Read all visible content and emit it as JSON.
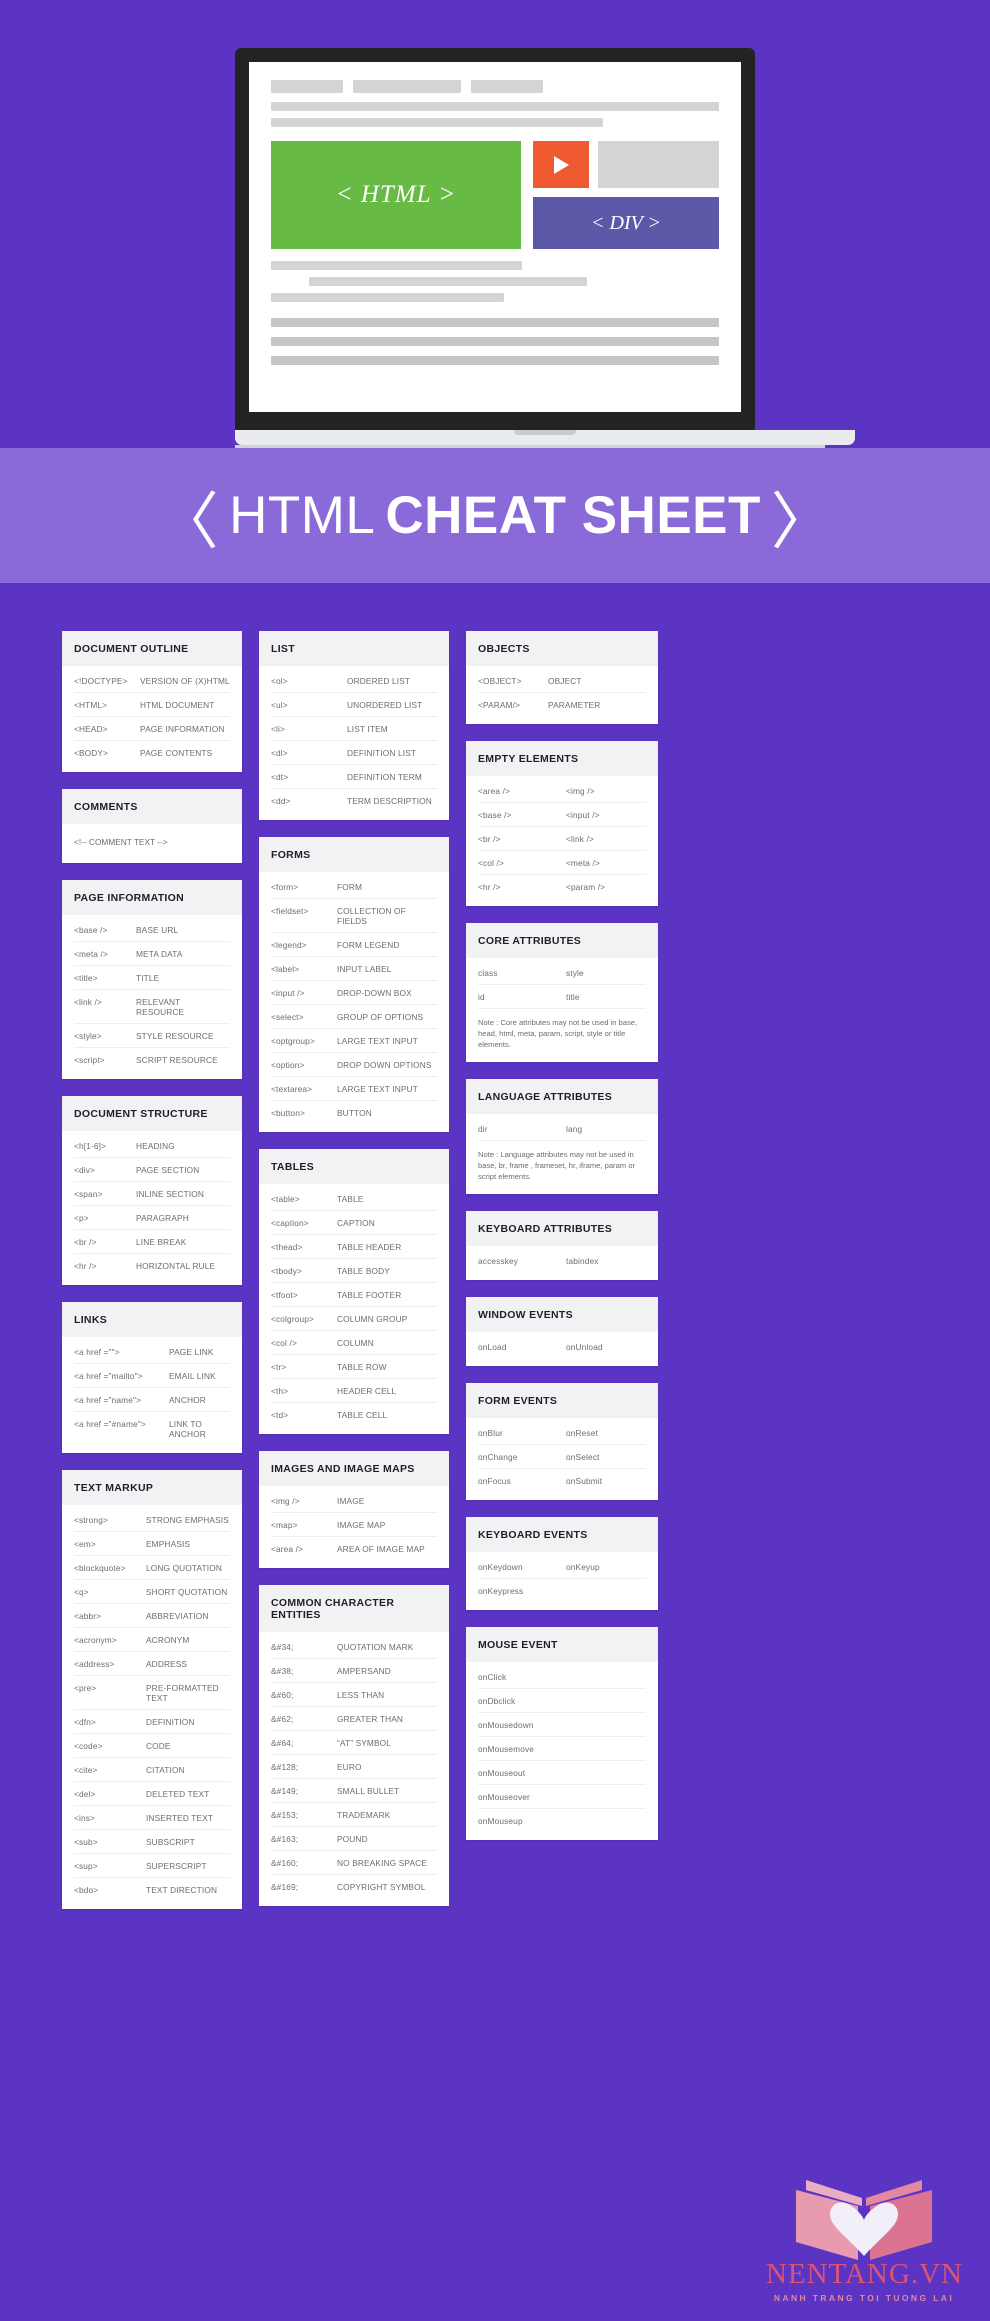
{
  "hero": {
    "green_block_label": "< HTML >",
    "div_block_label": "< DIV >"
  },
  "header": {
    "angle_open": "〈",
    "angle_close": "〉",
    "title_light": "HTML",
    "title_bold": "CHEAT SHEET"
  },
  "columns": [
    {
      "cards": [
        {
          "title": "DOCUMENT OUTLINE",
          "layout": "w-outline",
          "rows": [
            [
              "<!DOCTYPE>",
              "VERSION OF (X)HTML"
            ],
            [
              "<HTML>",
              "HTML DOCUMENT"
            ],
            [
              "<HEAD>",
              "PAGE INFORMATION"
            ],
            [
              "<BODY>",
              "PAGE CONTENTS"
            ]
          ]
        },
        {
          "title": "COMMENTS",
          "layout": "w-outline",
          "single": "<!-- COMMENT TEXT -->"
        },
        {
          "title": "PAGE INFORMATION",
          "layout": "w-pageinfo",
          "rows": [
            [
              "<base />",
              "BASE URL"
            ],
            [
              "<meta />",
              "META DATA"
            ],
            [
              "<title>",
              "TITLE"
            ],
            [
              "<link />",
              "RELEVANT RESOURCE"
            ],
            [
              "<style>",
              "STYLE RESOURCE"
            ],
            [
              "<script>",
              "SCRIPT RESOURCE"
            ]
          ]
        },
        {
          "title": "DOCUMENT STRUCTURE",
          "layout": "w-struct",
          "rows": [
            [
              "<h[1-6]>",
              "HEADING"
            ],
            [
              "<div>",
              "PAGE SECTION"
            ],
            [
              "<span>",
              "INLINE SECTION"
            ],
            [
              "<p>",
              "PARAGRAPH"
            ],
            [
              "<br />",
              "LINE BREAK"
            ],
            [
              "<hr />",
              "HORIZONTAL RULE"
            ]
          ]
        },
        {
          "title": "LINKS",
          "layout": "w-links",
          "rows": [
            [
              "<a href =\"\">",
              "PAGE LINK"
            ],
            [
              "<a href =\"mailto\">",
              "EMAIL LINK"
            ],
            [
              "<a href =\"name\">",
              "ANCHOR"
            ],
            [
              "<a href =\"#name\">",
              "LINK TO ANCHOR"
            ]
          ]
        },
        {
          "title": "TEXT MARKUP",
          "layout": "w-text",
          "rows": [
            [
              "<strong>",
              "STRONG EMPHASIS"
            ],
            [
              "<em>",
              "EMPHASIS"
            ],
            [
              "<blockquote>",
              "LONG QUOTATION"
            ],
            [
              "<q>",
              "SHORT QUOTATION"
            ],
            [
              "<abbr>",
              "ABBREVIATION"
            ],
            [
              "<acronym>",
              "ACRONYM"
            ],
            [
              "<address>",
              "ADDRESS"
            ],
            [
              "<pre>",
              "PRE-FORMATTED TEXT"
            ],
            [
              "<dfn>",
              "DEFINITION"
            ],
            [
              "<code>",
              "CODE"
            ],
            [
              "<cite>",
              "CITATION"
            ],
            [
              "<del>",
              "DELETED TEXT"
            ],
            [
              "<ins>",
              "INSERTED TEXT"
            ],
            [
              "<sub>",
              "SUBSCRIPT"
            ],
            [
              "<sup>",
              "SUPERSCRIPT"
            ],
            [
              "<bdo>",
              "TEXT DIRECTION"
            ]
          ]
        }
      ]
    },
    {
      "cards": [
        {
          "title": "LIST",
          "layout": "w-list",
          "rows": [
            [
              "<ol>",
              "ORDERED LIST"
            ],
            [
              "<ul>",
              "UNORDERED LIST"
            ],
            [
              "<li>",
              "LIST ITEM"
            ],
            [
              "<dl>",
              "DEFINITION LIST"
            ],
            [
              "<dt>",
              "DEFINITION TERM"
            ],
            [
              "<dd>",
              "TERM DESCRIPTION"
            ]
          ]
        },
        {
          "title": "FORMS",
          "layout": "w-forms",
          "rows": [
            [
              "<form>",
              "FORM"
            ],
            [
              "<fieldset>",
              "COLLECTION OF FIELDS"
            ],
            [
              "<legend>",
              "FORM LEGEND"
            ],
            [
              "<label>",
              "INPUT LABEL"
            ],
            [
              "<input />",
              "DROP-DOWN BOX"
            ],
            [
              "<select>",
              "GROUP OF OPTIONS"
            ],
            [
              "<optgroup>",
              "LARGE TEXT INPUT"
            ],
            [
              "<option>",
              "DROP DOWN OPTIONS"
            ],
            [
              "<textarea>",
              "LARGE TEXT INPUT"
            ],
            [
              "<button>",
              "BUTTON"
            ]
          ]
        },
        {
          "title": "TABLES",
          "layout": "w-tables",
          "rows": [
            [
              "<table>",
              "TABLE"
            ],
            [
              "<caption>",
              "CAPTION"
            ],
            [
              "<thead>",
              "TABLE HEADER"
            ],
            [
              "<tbody>",
              "TABLE BODY"
            ],
            [
              "<tfoot>",
              "TABLE FOOTER"
            ],
            [
              "<colgroup>",
              "COLUMN GROUP"
            ],
            [
              "<col />",
              "COLUMN"
            ],
            [
              "<tr>",
              "TABLE ROW"
            ],
            [
              "<th>",
              "HEADER CELL"
            ],
            [
              "<td>",
              "TABLE CELL"
            ]
          ]
        },
        {
          "title": "IMAGES AND IMAGE MAPS",
          "layout": "w-img",
          "rows": [
            [
              "<img />",
              "IMAGE"
            ],
            [
              "<map>",
              "IMAGE MAP"
            ],
            [
              "<area />",
              "AREA OF IMAGE MAP"
            ]
          ]
        },
        {
          "title": "COMMON CHARACTER ENTITIES",
          "layout": "w-ent",
          "rows": [
            [
              "&#34;",
              "QUOTATION MARK"
            ],
            [
              "&#38;",
              "AMPERSAND"
            ],
            [
              "&#60;",
              "LESS THAN"
            ],
            [
              "&#62;",
              "GREATER THAN"
            ],
            [
              "&#64;",
              "“AT” SYMBOL"
            ],
            [
              "&#128;",
              "EURO"
            ],
            [
              "&#149;",
              "SMALL BULLET"
            ],
            [
              "&#153;",
              "TRADEMARK"
            ],
            [
              "&#163;",
              "POUND"
            ],
            [
              "&#160;",
              "NO BREAKING SPACE"
            ],
            [
              "&#169;",
              "COPYRIGHT SYMBOL"
            ]
          ]
        }
      ]
    },
    {
      "cards": [
        {
          "title": "OBJECTS",
          "layout": "w-obj",
          "rows": [
            [
              "<OBJECT>",
              "OBJECT"
            ],
            [
              "<PARAM/>",
              "PARAMETER"
            ]
          ]
        },
        {
          "title": "EMPTY ELEMENTS",
          "layout": "w-two",
          "rows": [
            [
              "<area />",
              "<img />"
            ],
            [
              "<base />",
              "<input />"
            ],
            [
              "<br />",
              "<link />"
            ],
            [
              "<col />",
              "<meta />"
            ],
            [
              "<hr />",
              "<param />"
            ]
          ]
        },
        {
          "title": "CORE ATTRIBUTES",
          "layout": "w-two",
          "rows": [
            [
              "class",
              "style"
            ],
            [
              "id",
              "title"
            ]
          ],
          "note": "Note : Core attributes may not be used in base, head, html, meta, param, script, style or title elements."
        },
        {
          "title": "LANGUAGE ATTRIBUTES",
          "layout": "w-two",
          "rows": [
            [
              "dir",
              "lang"
            ]
          ],
          "note": "Note : Language attributes may not be used in base, br, frame , frameset, hr, iframe, param or script elements."
        },
        {
          "title": "KEYBOARD ATTRIBUTES",
          "layout": "w-two",
          "rows": [
            [
              "accesskey",
              "tabindex"
            ]
          ]
        },
        {
          "title": "WINDOW EVENTS",
          "layout": "w-two",
          "rows": [
            [
              "onLoad",
              "onUnload"
            ]
          ]
        },
        {
          "title": "FORM EVENTS",
          "layout": "w-two",
          "rows": [
            [
              "onBlur",
              "onReset"
            ],
            [
              "onChange",
              "onSelect"
            ],
            [
              "onFocus",
              "onSubmit"
            ]
          ]
        },
        {
          "title": "KEYBOARD EVENTS",
          "layout": "w-two",
          "rows": [
            [
              "onKeydown",
              "onKeyup"
            ],
            [
              "onKeypress",
              ""
            ]
          ]
        },
        {
          "title": "MOUSE EVENT",
          "layout": "w-two",
          "rows": [
            [
              "onClick",
              ""
            ],
            [
              "onDbclick",
              ""
            ],
            [
              "onMousedown",
              ""
            ],
            [
              "onMousemove",
              ""
            ],
            [
              "onMouseout",
              ""
            ],
            [
              "onMouseover",
              ""
            ],
            [
              "onMouseup",
              ""
            ]
          ]
        }
      ]
    }
  ],
  "footer": {
    "logo_name": "NENTANG.VN",
    "logo_tagline": "NANH TRANG TOI TUONG LAI"
  },
  "colors": {
    "background_purple": "#5b34c4",
    "band_purple": "#8a6ad8",
    "card_white": "#ffffff",
    "card_header_grey": "#f2f2f4",
    "green": "#67bb45",
    "orange": "#ef5a30",
    "indigo": "#5c5aa8",
    "logo_pink": "#e8576b"
  }
}
